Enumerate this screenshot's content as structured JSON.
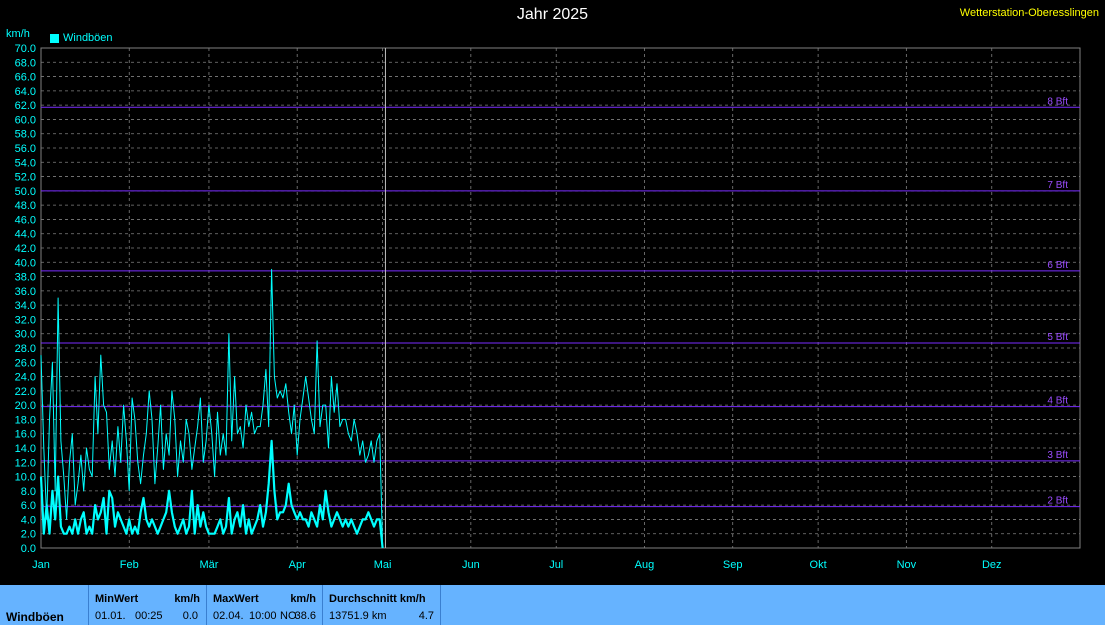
{
  "header": {
    "title": "Jahr 2025",
    "station": "Wetterstation-Oberesslingen",
    "unit": "km/h",
    "legend_label": "Windböen"
  },
  "chart_data": {
    "type": "line",
    "title": "Jahr 2025",
    "ylabel": "km/h",
    "xlabel": "",
    "ylim": [
      0,
      70
    ],
    "y_ticks": [
      "0.0",
      "2.0",
      "4.0",
      "6.0",
      "8.0",
      "10.0",
      "12.0",
      "14.0",
      "16.0",
      "18.0",
      "20.0",
      "22.0",
      "24.0",
      "26.0",
      "28.0",
      "30.0",
      "32.0",
      "34.0",
      "36.0",
      "38.0",
      "40.0",
      "42.0",
      "44.0",
      "46.0",
      "48.0",
      "50.0",
      "52.0",
      "54.0",
      "56.0",
      "58.0",
      "60.0",
      "62.0",
      "64.0",
      "66.0",
      "68.0",
      "70.0"
    ],
    "x_ticks": [
      "Jan",
      "Feb",
      "Mär",
      "Apr",
      "Mai",
      "Jun",
      "Jul",
      "Aug",
      "Sep",
      "Okt",
      "Nov",
      "Dez"
    ],
    "grid": true,
    "legend_position": "top-left",
    "beaufort_lines": [
      {
        "label": "2 Bft",
        "value": 5.8
      },
      {
        "label": "3 Bft",
        "value": 12.2
      },
      {
        "label": "4 Bft",
        "value": 19.8
      },
      {
        "label": "5 Bft",
        "value": 28.7
      },
      {
        "label": "6 Bft",
        "value": 38.8
      },
      {
        "label": "7 Bft",
        "value": 50.0
      },
      {
        "label": "8 Bft",
        "value": 61.7
      }
    ],
    "series": [
      {
        "name": "Windböen",
        "color": "#00ffff",
        "x": [
          1,
          2,
          3,
          4,
          5,
          6,
          7,
          8,
          9,
          10,
          11,
          12,
          13,
          14,
          15,
          16,
          17,
          18,
          19,
          20,
          21,
          22,
          23,
          24,
          25,
          26,
          27,
          28,
          29,
          30,
          31,
          32,
          33,
          34,
          35,
          36,
          37,
          38,
          39,
          40,
          41,
          42,
          43,
          44,
          45,
          46,
          47,
          48,
          49,
          50,
          51,
          52,
          53,
          54,
          55,
          56,
          57,
          58,
          59,
          60,
          61,
          62,
          63,
          64,
          65,
          66,
          67,
          68,
          69,
          70,
          71,
          72,
          73,
          74,
          75,
          76,
          77,
          78,
          79,
          80,
          81,
          82,
          83,
          84,
          85,
          86,
          87,
          88,
          89,
          90,
          91,
          92,
          93,
          94,
          95,
          96,
          97,
          98,
          99,
          100,
          101,
          102,
          103,
          104,
          105,
          106,
          107,
          108,
          109,
          110,
          111,
          112,
          113,
          114,
          115,
          116,
          117,
          118,
          119,
          120,
          121
        ],
        "values": [
          27,
          14,
          4,
          18,
          26,
          8,
          35,
          15,
          10,
          4,
          12,
          16,
          6,
          9,
          13,
          8,
          14,
          11,
          10,
          24,
          16,
          27,
          20,
          19,
          11,
          15,
          10,
          17,
          12,
          20,
          15,
          8,
          21,
          18,
          12,
          9,
          13,
          16,
          22,
          18,
          9,
          14,
          20,
          11,
          16,
          13,
          22,
          18,
          10,
          15,
          12,
          18,
          16,
          11,
          14,
          17,
          21,
          12,
          15,
          20,
          16,
          10,
          19,
          13,
          16,
          13,
          30,
          15,
          24,
          16,
          17,
          14,
          20,
          17,
          19,
          16,
          17,
          17,
          20,
          25,
          17,
          39,
          24,
          21,
          22,
          21,
          23,
          19,
          16,
          20,
          13,
          18,
          21,
          24,
          21,
          18,
          16,
          29,
          17,
          20,
          20,
          14,
          24,
          19,
          23,
          17,
          18,
          18,
          16,
          15,
          18,
          16,
          13,
          15,
          12,
          13,
          15,
          12,
          15,
          16,
          0
        ]
      },
      {
        "name": "",
        "color": "#00ffff",
        "x": [
          1,
          2,
          3,
          4,
          5,
          6,
          7,
          8,
          9,
          10,
          11,
          12,
          13,
          14,
          15,
          16,
          17,
          18,
          19,
          20,
          21,
          22,
          23,
          24,
          25,
          26,
          27,
          28,
          29,
          30,
          31,
          32,
          33,
          34,
          35,
          36,
          37,
          38,
          39,
          40,
          41,
          42,
          43,
          44,
          45,
          46,
          47,
          48,
          49,
          50,
          51,
          52,
          53,
          54,
          55,
          56,
          57,
          58,
          59,
          60,
          61,
          62,
          63,
          64,
          65,
          66,
          67,
          68,
          69,
          70,
          71,
          72,
          73,
          74,
          75,
          76,
          77,
          78,
          79,
          80,
          81,
          82,
          83,
          84,
          85,
          86,
          87,
          88,
          89,
          90,
          91,
          92,
          93,
          94,
          95,
          96,
          97,
          98,
          99,
          100,
          101,
          102,
          103,
          104,
          105,
          106,
          107,
          108,
          109,
          110,
          111,
          112,
          113,
          114,
          115,
          116,
          117,
          118,
          119,
          120,
          121
        ],
        "values": [
          10,
          2,
          6,
          2,
          8,
          4,
          10,
          3,
          2,
          2,
          3,
          2,
          4,
          2,
          4,
          5,
          2,
          3,
          2,
          6,
          4,
          5,
          7,
          2,
          8,
          7,
          3,
          5,
          4,
          3,
          2,
          4,
          2,
          3,
          2,
          5,
          7,
          4,
          3,
          4,
          3,
          2,
          3,
          4,
          5,
          8,
          5,
          3,
          2,
          3,
          4,
          2,
          3,
          8,
          2,
          6,
          3,
          5,
          3,
          2,
          2,
          2,
          3,
          4,
          2,
          3,
          7,
          2,
          4,
          5,
          3,
          6,
          2,
          4,
          2,
          3,
          4,
          6,
          3,
          5,
          9,
          15,
          8,
          4,
          5,
          5,
          6,
          9,
          6,
          5,
          4,
          5,
          4,
          4,
          3,
          5,
          4,
          3,
          6,
          4,
          8,
          5,
          3,
          4,
          5,
          4,
          3,
          4,
          3,
          4,
          3,
          2,
          3,
          4,
          4,
          5,
          4,
          3,
          4,
          4,
          0
        ]
      }
    ]
  },
  "stats": {
    "row_label": "Windböen",
    "min": {
      "header": "MinWert",
      "unit": "km/h",
      "date": "01.01.",
      "time": "00:25",
      "value": "0.0"
    },
    "max": {
      "header": "MaxWert",
      "unit": "km/h",
      "date": "02.04.",
      "time": "10:00",
      "dir": "NO",
      "value": "38.6"
    },
    "avg": {
      "header": "Durchschnitt km/h",
      "distance": "13751.9 km",
      "value": "4.7"
    }
  }
}
